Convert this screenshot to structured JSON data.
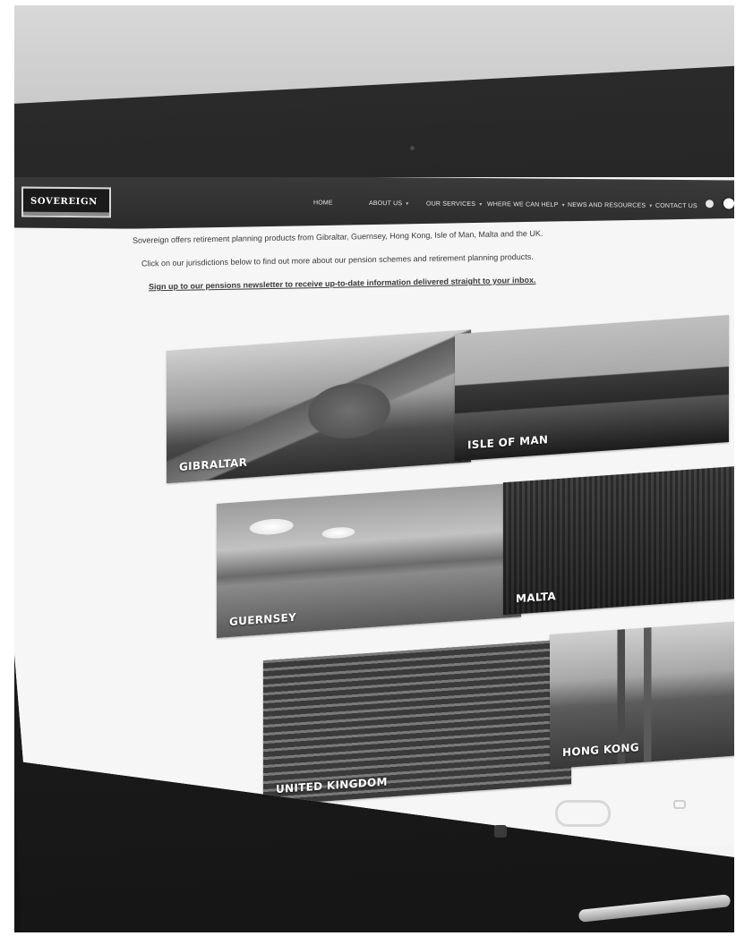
{
  "header": {
    "logo_text": "SOVEREIGN",
    "nav": [
      {
        "label": "HOME",
        "caret": false
      },
      {
        "label": "ABOUT US",
        "caret": true
      },
      {
        "label": "OUR SERVICES",
        "caret": true
      },
      {
        "label": "WHERE WE CAN HELP",
        "caret": true
      },
      {
        "label": "NEWS AND RESOURCES",
        "caret": true
      },
      {
        "label": "CONTACT US",
        "caret": false
      }
    ]
  },
  "intro": {
    "line1": "Sovereign offers retirement planning products from Gibraltar, Guernsey, Hong Kong, Isle of Man, Malta and the UK.",
    "line2": "Click on our jurisdictions below to find out more about our pension schemes and retirement planning products.",
    "newsletter_link": "Sign up to our pensions newsletter to receive up-to-date information delivered straight to your inbox."
  },
  "jurisdictions": [
    {
      "label": "GIBRALTAR"
    },
    {
      "label": "ISLE OF MAN"
    },
    {
      "label": "GUERNSEY"
    },
    {
      "label": "MALTA"
    },
    {
      "label": "UNITED KINGDOM"
    },
    {
      "label": "HONG KONG"
    }
  ],
  "colors": {
    "navbar": "#2b2b2b",
    "page_bg": "#f6f6f6",
    "text": "#3a3a3a"
  }
}
